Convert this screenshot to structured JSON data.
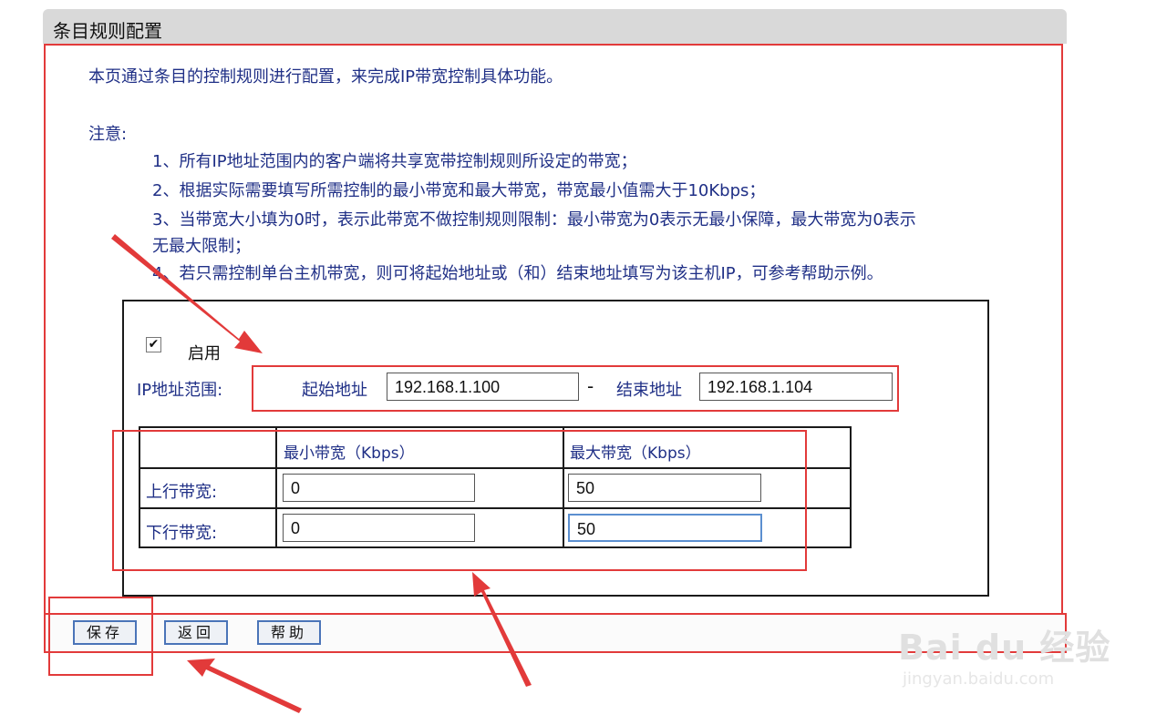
{
  "header": {
    "title": "条目规则配置"
  },
  "intro": "本页通过条目的控制规则进行配置，来完成IP带宽控制具体功能。",
  "notes": {
    "title": "注意:",
    "items": [
      "1、所有IP地址范围内的客户端将共享宽带控制规则所设定的带宽；",
      "2、根据实际需要填写所需控制的最小带宽和最大带宽，带宽最小值需大于10Kbps；",
      "3、当带宽大小填为0时，表示此带宽不做控制规则限制：最小带宽为0表示无最小保障，最大带宽为0表示",
      "无最大限制；",
      "4、若只需控制单台主机带宽，则可将起始地址或（和）结束地址填写为该主机IP，可参考帮助示例。"
    ]
  },
  "form": {
    "enable_label": "启用",
    "enable_checked": true,
    "ip_range_label": "IP地址范围:",
    "start_label": "起始地址",
    "start_value": "192.168.1.100",
    "separator": "-",
    "end_label": "结束地址",
    "end_value": "192.168.1.104"
  },
  "bandwidth": {
    "col_min": "最小带宽（Kbps）",
    "col_max": "最大带宽（Kbps）",
    "up_label": "上行带宽:",
    "up_min": "0",
    "up_max": "50",
    "down_label": "下行带宽:",
    "down_min": "0",
    "down_max": "50"
  },
  "buttons": {
    "save": "保存",
    "back": "返回",
    "help": "帮助"
  },
  "watermark": {
    "main": "Bai du 经验",
    "sub": "jingyan.baidu.com"
  },
  "colors": {
    "annotation_red": "#e23a3a",
    "text_blue": "#1f2f86",
    "button_border": "#4a74b8"
  }
}
